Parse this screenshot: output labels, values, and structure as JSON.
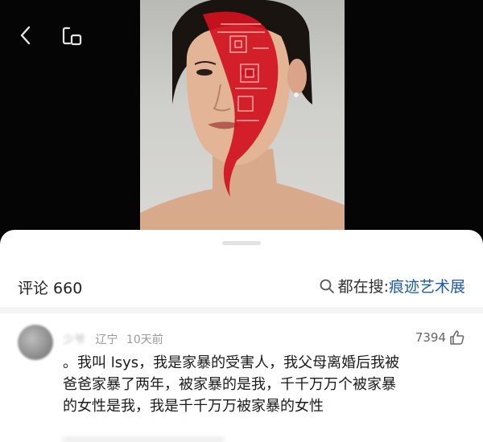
{
  "colors": {
    "link": "#1d5ba8",
    "paint_red": "#d1121f",
    "sheet_bg": "#ffffff",
    "top_bg": "#050505"
  },
  "top_bar": {
    "back_icon": "chevron-left-icon",
    "window_icon": "floating-window-icon"
  },
  "photo": {
    "subject": "portrait-image"
  },
  "comments_header": {
    "count_label": "评论 660",
    "search_label": "都在搜:",
    "search_term": "痕迹艺术展",
    "search_icon": "search-icon"
  },
  "comment": {
    "username": "少爷",
    "location": "辽宁",
    "time": "10天前",
    "likes": "7394",
    "like_icon": "thumbs-up-icon",
    "text": "。我叫 lsys，我是家暴的受害人，我父母离婚后我被\n爸爸家暴了两年，被家暴的是我，千千万万个被家暴\n的女性是我，我是千千万万被家暴的女性"
  }
}
